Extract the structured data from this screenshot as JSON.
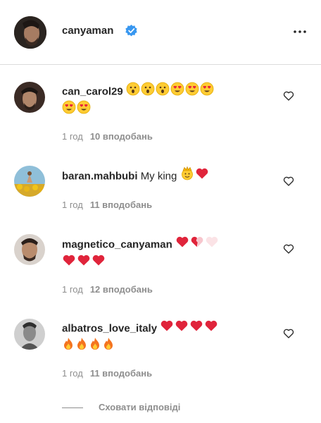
{
  "header": {
    "username": "canyaman",
    "verified": true,
    "avatar_icon": "profile-photo",
    "more_icon": "more-horizontal-icon"
  },
  "comments": [
    {
      "username": "can_carol29",
      "text": "",
      "emojis_line1": [
        "astonished",
        "astonished",
        "astonished",
        "heart-eyes",
        "heart-eyes",
        "heart-eyes"
      ],
      "emojis_line2": [
        "heart-eyes",
        "heart-eyes"
      ],
      "time": "1 год",
      "likes": "10 вподобань"
    },
    {
      "username": "baran.mahbubi",
      "text": "My king",
      "emojis_line1": [
        "crown-face",
        "red-heart"
      ],
      "emojis_line2": [],
      "time": "1 год",
      "likes": "11 вподобань"
    },
    {
      "username": "magnetico_canyaman",
      "text": "",
      "emojis_line1": [
        "red-heart",
        "half-heart",
        "pale-heart"
      ],
      "emojis_line2": [
        "red-heart",
        "red-heart",
        "red-heart"
      ],
      "time": "1 год",
      "likes": "12 вподобань"
    },
    {
      "username": "albatros_love_italy",
      "text": "",
      "emojis_line1": [
        "red-heart",
        "red-heart",
        "red-heart",
        "red-heart"
      ],
      "emojis_line2": [
        "fire",
        "fire",
        "fire",
        "fire"
      ],
      "time": "1 год",
      "likes": "11 вподобань"
    }
  ],
  "footer": {
    "hide_replies": "Сховати відповіді"
  },
  "colors": {
    "text": "#262626",
    "muted": "#8e8e8e",
    "verified_blue": "#3897f0",
    "divider": "#dbdbdb"
  }
}
